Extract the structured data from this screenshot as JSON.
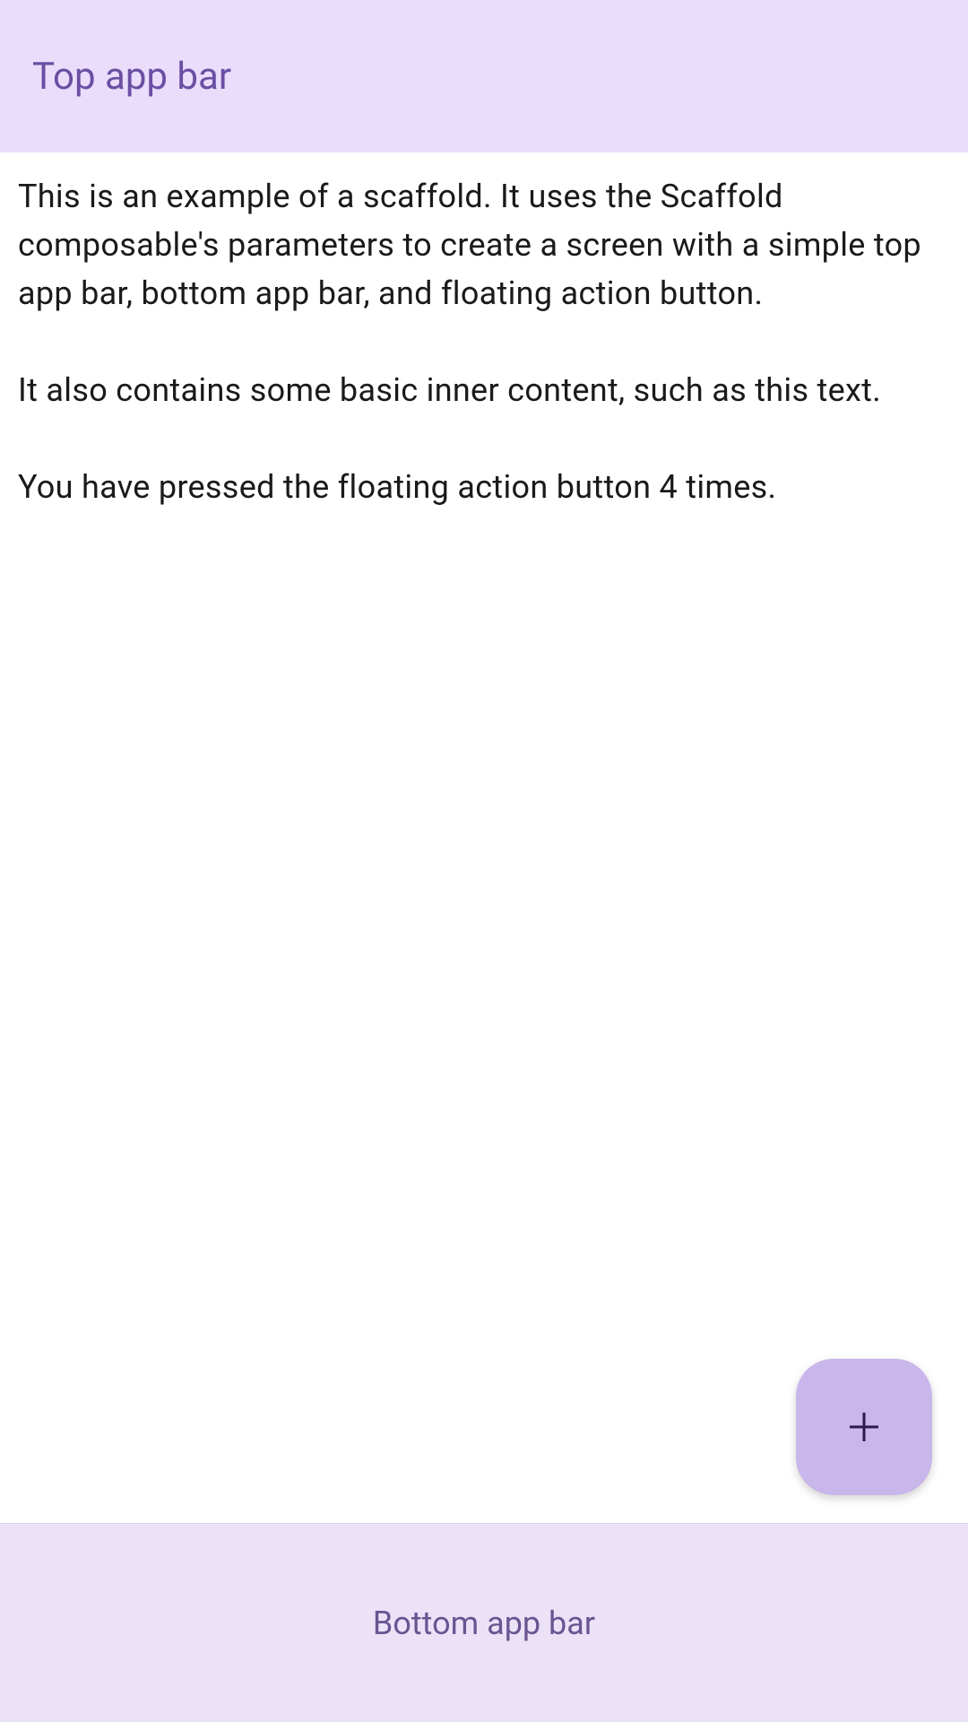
{
  "top_bar": {
    "title": "Top app bar"
  },
  "content": {
    "body_text": "This is an example of a scaffold. It uses the Scaffold composable's parameters to create a screen with a simple top app bar, bottom app bar, and floating action button.\n\nIt also contains some basic inner content, such as this text.\n\nYou have pressed the floating action button 4 times.",
    "press_count": 4
  },
  "bottom_bar": {
    "title": "Bottom app bar"
  },
  "fab": {
    "icon": "add"
  },
  "colors": {
    "top_bar_bg": "#e9ddfb",
    "top_bar_text": "#6a4fa3",
    "bottom_bar_bg": "#ebe2f8",
    "bottom_bar_text": "#6a5491",
    "fab_bg": "#c9b6ea",
    "fab_icon": "#2f1a4a"
  }
}
